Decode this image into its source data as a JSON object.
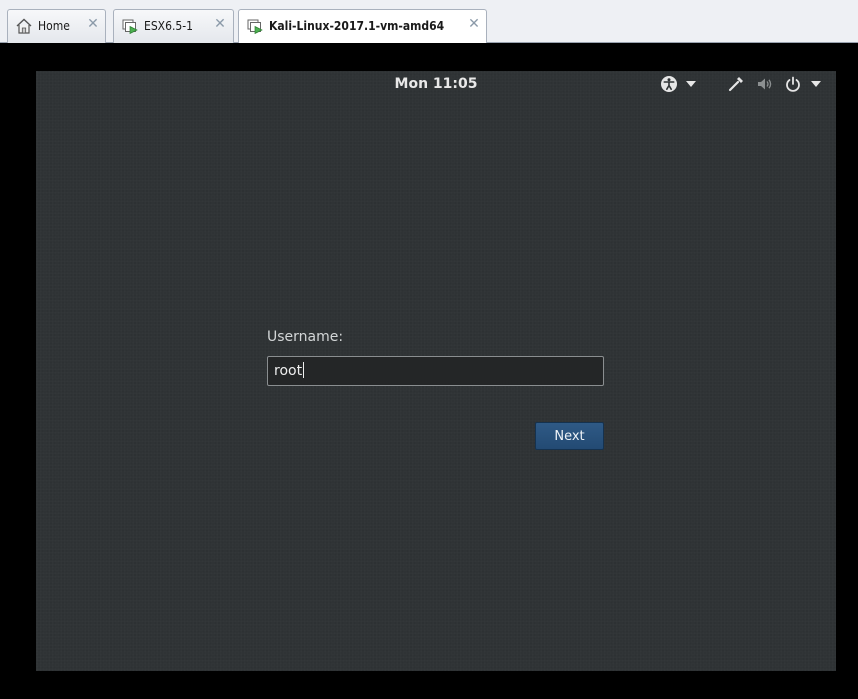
{
  "host": {
    "tabs": [
      {
        "label": "Home",
        "icon": "home-icon",
        "active": false
      },
      {
        "label": "ESX6.5-1",
        "icon": "vm-icon",
        "active": false
      },
      {
        "label": "Kali-Linux-2017.1-vm-amd64",
        "icon": "vm-icon",
        "active": true
      }
    ],
    "close_glyph": "✕"
  },
  "vm": {
    "topbar": {
      "clock": "Mon 11:05",
      "icons": [
        "accessibility-icon",
        "chevron-down-icon",
        "keyboard-icon",
        "volume-icon",
        "power-icon",
        "chevron-down-icon"
      ]
    },
    "login": {
      "username_label": "Username:",
      "username_value": "root",
      "next_label": "Next"
    }
  },
  "colors": {
    "screen_bg": "#2f3335",
    "next_button": "#2a5079",
    "vm_running_badge": "#4caf50"
  }
}
